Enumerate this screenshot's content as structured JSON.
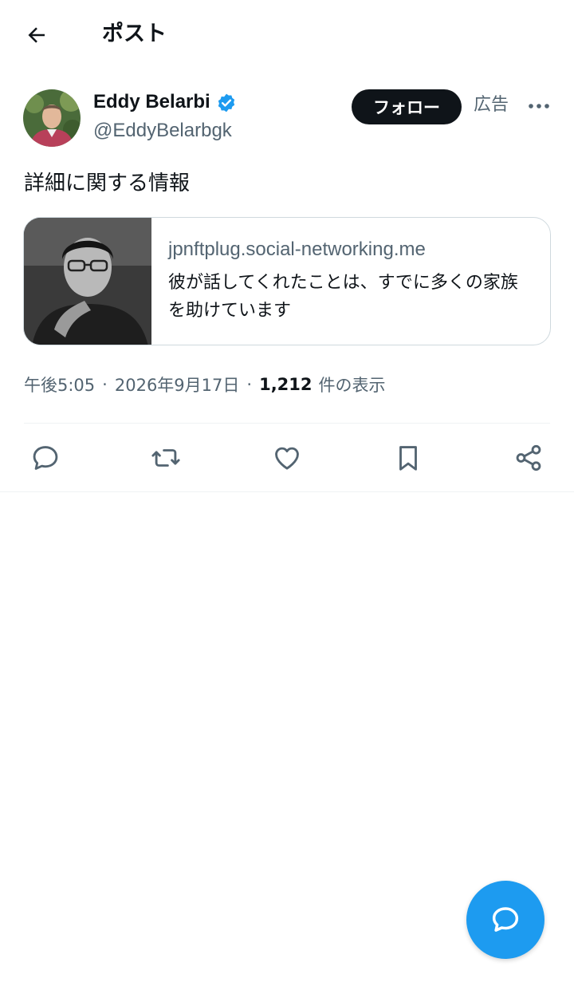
{
  "header": {
    "title": "ポスト",
    "back_icon": "arrow-left-icon"
  },
  "post": {
    "author": {
      "name": "Eddy Belarbi",
      "handle": "@EddyBelarbgk",
      "verified": true,
      "verified_color": "#1d9bf0"
    },
    "follow_label": "フォロー",
    "ad_label": "広告",
    "text": "詳細に関する情報",
    "card": {
      "domain": "jpnftplug.social-networking.me",
      "title": "彼が話してくれたことは、すでに多くの家族を助けています"
    },
    "meta": {
      "time": "午後5:05",
      "separator": "·",
      "date": "2026年9月17日",
      "views_count": "1,212",
      "views_label": "件の表示"
    }
  },
  "actions": [
    "reply-icon",
    "repost-icon",
    "like-icon",
    "bookmark-icon",
    "share-icon"
  ],
  "colors": {
    "accent": "#1d9bf0",
    "text_primary": "#0f1419",
    "text_secondary": "#536471",
    "border": "#cfd9de"
  }
}
